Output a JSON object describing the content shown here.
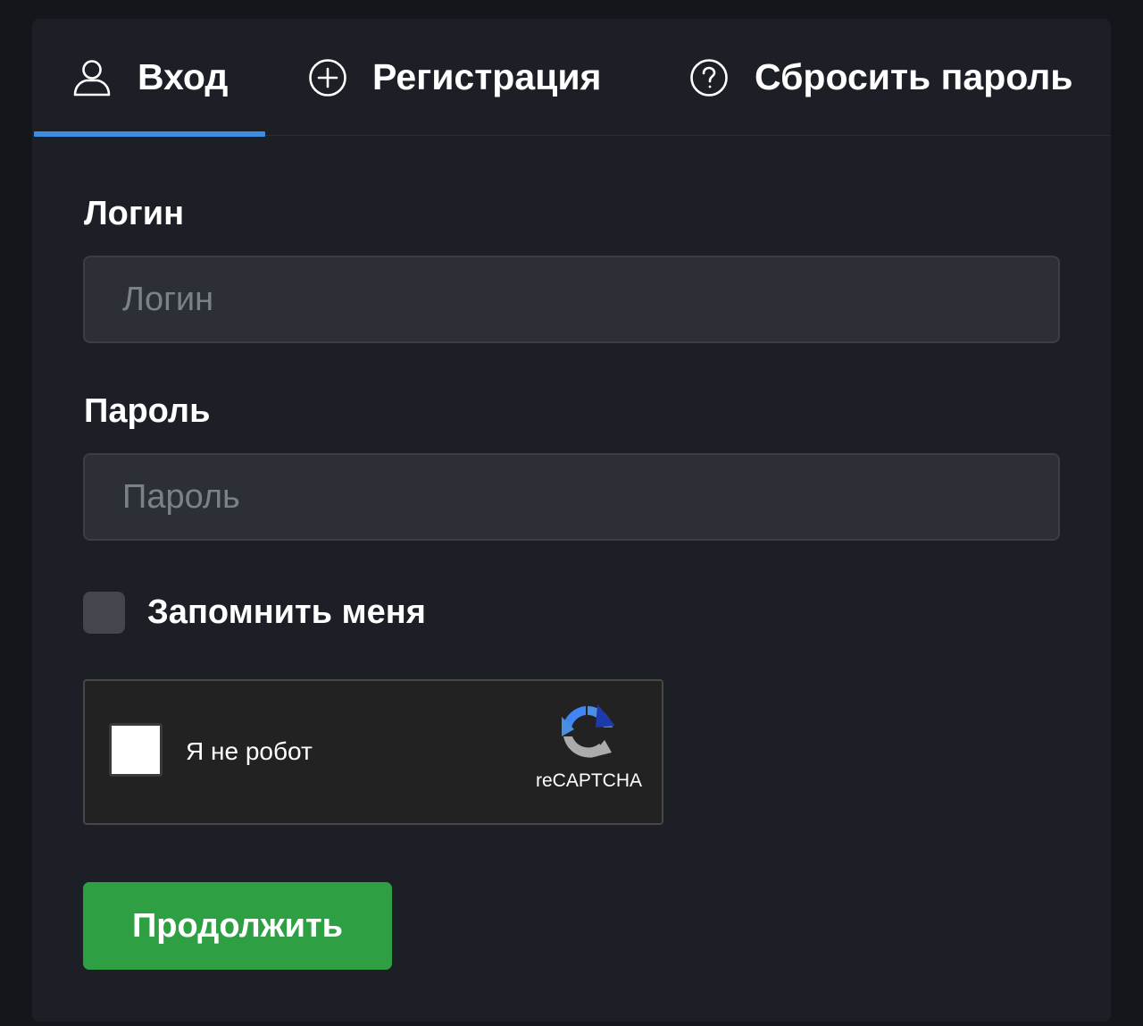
{
  "tabs": [
    {
      "label": "Вход",
      "icon": "user-icon",
      "active": true
    },
    {
      "label": "Регистрация",
      "icon": "plus-circle-icon",
      "active": false
    },
    {
      "label": "Сбросить пароль",
      "icon": "question-circle-icon",
      "active": false
    }
  ],
  "form": {
    "login_label": "Логин",
    "login_placeholder": "Логин",
    "login_value": "",
    "password_label": "Пароль",
    "password_placeholder": "Пароль",
    "password_value": "",
    "remember_label": "Запомнить меня",
    "remember_checked": false,
    "captcha": {
      "label": "Я не робот",
      "brand": "reCAPTCHA",
      "checked": false
    },
    "submit_label": "Продолжить"
  },
  "colors": {
    "accent": "#3d8ee0",
    "submit": "#2ea043",
    "panel_bg": "#1c1f26",
    "page_bg": "#13161b"
  }
}
